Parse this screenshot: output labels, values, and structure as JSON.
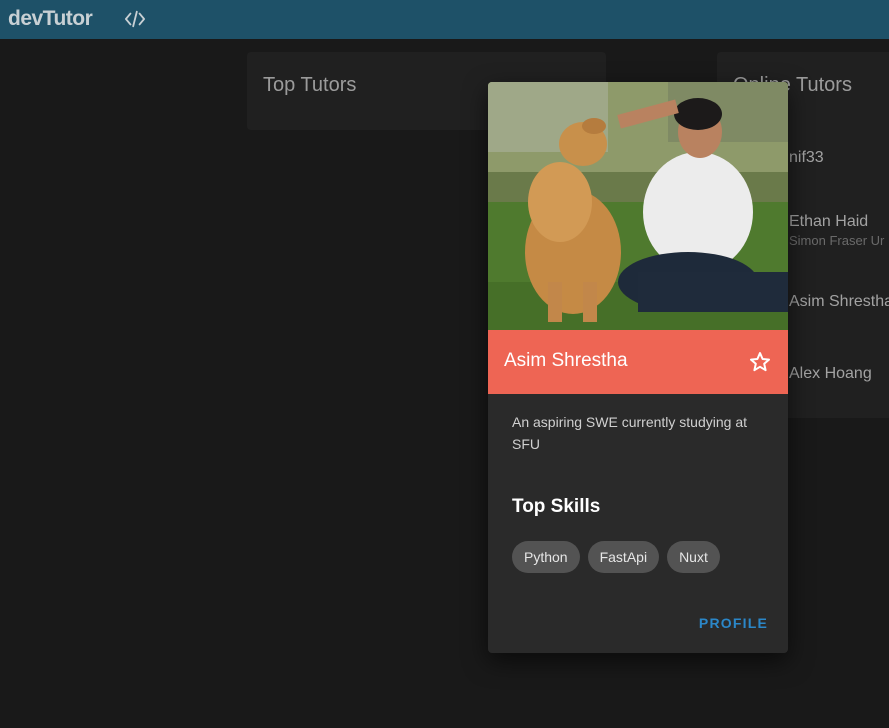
{
  "appbar": {
    "logo": "devTutor",
    "code_icon": "code-icon"
  },
  "top_tutors": {
    "title": "Top Tutors"
  },
  "online_tutors": {
    "title": "Online Tutors",
    "items": [
      {
        "name": "nif33",
        "school": ""
      },
      {
        "name": "Ethan Haid",
        "school": "Simon Fraser Ur"
      },
      {
        "name": "Asim Shrestha",
        "school": ""
      },
      {
        "name": "Alex Hoang",
        "school": ""
      }
    ]
  },
  "tutor_card": {
    "name": "Asim Shrestha",
    "bio": "An aspiring SWE currently studying at SFU",
    "skills_title": "Top Skills",
    "skills": [
      "Python",
      "FastApi",
      "Nuxt"
    ],
    "profile_label": "PROFILE",
    "star_icon": "star-outline-icon",
    "accent_color": "#ee6554"
  }
}
